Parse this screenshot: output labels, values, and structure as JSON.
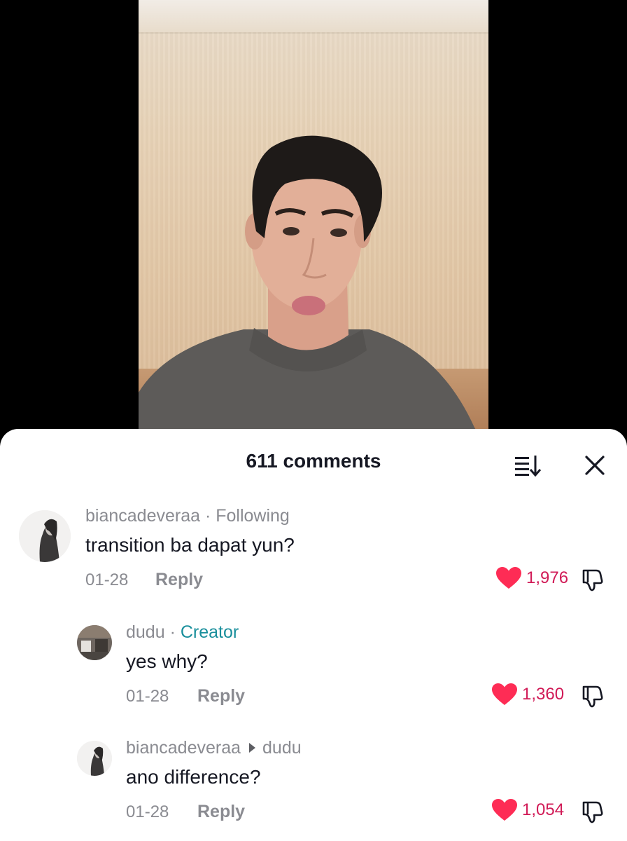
{
  "header": {
    "title": "611 comments",
    "sort_icon": "sort-list-icon",
    "close_icon": "close-icon"
  },
  "colors": {
    "like": "#FE2C55",
    "like_count": "#D11B57",
    "creator_tag": "#1A8F9C",
    "muted_text": "#8A8B91",
    "primary_text": "#161823"
  },
  "comments": [
    {
      "username": "biancadeveraa",
      "tag": "Following",
      "text": "transition ba dapat yun?",
      "date": "01-28",
      "reply_label": "Reply",
      "likes": "1,976",
      "liked": true
    },
    {
      "username": "dudu",
      "tag": "Creator",
      "text": "yes why?",
      "date": "01-28",
      "reply_label": "Reply",
      "likes": "1,360",
      "liked": true
    },
    {
      "username": "biancadeveraa",
      "reply_to": "dudu",
      "text": "ano difference?",
      "date": "01-28",
      "reply_label": "Reply",
      "likes": "1,054",
      "liked": true
    }
  ]
}
